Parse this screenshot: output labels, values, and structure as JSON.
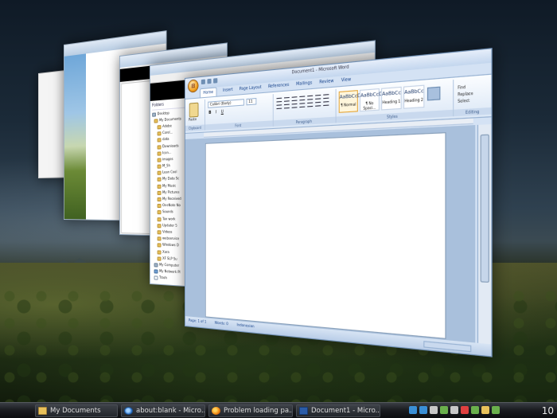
{
  "explorer_window": {
    "folders_header": "Folders",
    "tree": [
      {
        "label": "Desktop",
        "icon": "desktop"
      },
      {
        "label": "My Documents",
        "icon": "folder"
      },
      {
        "label": "Adobe",
        "icon": "folder"
      },
      {
        "label": "Corel...",
        "icon": "folder"
      },
      {
        "label": "data",
        "icon": "folder"
      },
      {
        "label": "Downloads",
        "icon": "folder"
      },
      {
        "label": "Icon...",
        "icon": "folder"
      },
      {
        "label": "images",
        "icon": "folder"
      },
      {
        "label": "M_Sh",
        "icon": "folder"
      },
      {
        "label": "Lean Cool",
        "icon": "folder"
      },
      {
        "label": "My Data Sc",
        "icon": "folder"
      },
      {
        "label": "My Music",
        "icon": "folder"
      },
      {
        "label": "My Pictures",
        "icon": "folder"
      },
      {
        "label": "My Received",
        "icon": "folder"
      },
      {
        "label": "OneNote No",
        "icon": "folder"
      },
      {
        "label": "Sounds",
        "icon": "folder"
      },
      {
        "label": "Tax work",
        "icon": "folder"
      },
      {
        "label": "Updater 5",
        "icon": "folder"
      },
      {
        "label": "Videos",
        "icon": "folder"
      },
      {
        "label": "webservice",
        "icon": "folder"
      },
      {
        "label": "Windows D",
        "icon": "folder"
      },
      {
        "label": "Xara",
        "icon": "folder"
      },
      {
        "label": "XF SLP Su",
        "icon": "folder"
      },
      {
        "label": "My Computer",
        "icon": "drive"
      },
      {
        "label": "My Network Pl",
        "icon": "net"
      },
      {
        "label": "Trash",
        "icon": "doc"
      }
    ]
  },
  "word_window": {
    "title": "Document1 - Microsoft Word",
    "tabs": [
      "Home",
      "Insert",
      "Page Layout",
      "References",
      "Mailings",
      "Review",
      "View"
    ],
    "paste_label": "Paste",
    "font_name": "Calibri (Body)",
    "font_size": "11",
    "groups": {
      "clipboard": "Clipboard",
      "font": "Font",
      "paragraph": "Paragraph",
      "styles": "Styles",
      "editing": "Editing"
    },
    "styles": [
      {
        "preview": "AaBbCcDc",
        "name": "¶ Normal",
        "selected": true
      },
      {
        "preview": "AaBbCcDc",
        "name": "¶ No Spaci...",
        "selected": false
      },
      {
        "preview": "AaBbCc",
        "name": "Heading 1",
        "selected": false
      },
      {
        "preview": "AaBbCc",
        "name": "Heading 2",
        "selected": false
      }
    ],
    "change_styles": "Change Styles",
    "editing": [
      "Find",
      "Replace",
      "Select"
    ],
    "status": {
      "page": "Page: 1 of 1",
      "words": "Words: 0",
      "lang": "Indonesian"
    }
  },
  "taskbar": {
    "buttons": [
      {
        "label": "My Documents",
        "icon": "folder-icon"
      },
      {
        "label": "about:blank - Micro...",
        "icon": "internet-explorer-icon"
      },
      {
        "label": "Problem loading pa...",
        "icon": "firefox-icon"
      },
      {
        "label": "Document1 - Micro...",
        "icon": "word-icon"
      }
    ],
    "clock": "10",
    "tray_colors": [
      "#3a8fd6",
      "#3a8fd6",
      "#c8c8c8",
      "#6ab04c",
      "#c8c8c8",
      "#e04040",
      "#6ab04c",
      "#e8c15a",
      "#6ab04c"
    ]
  }
}
